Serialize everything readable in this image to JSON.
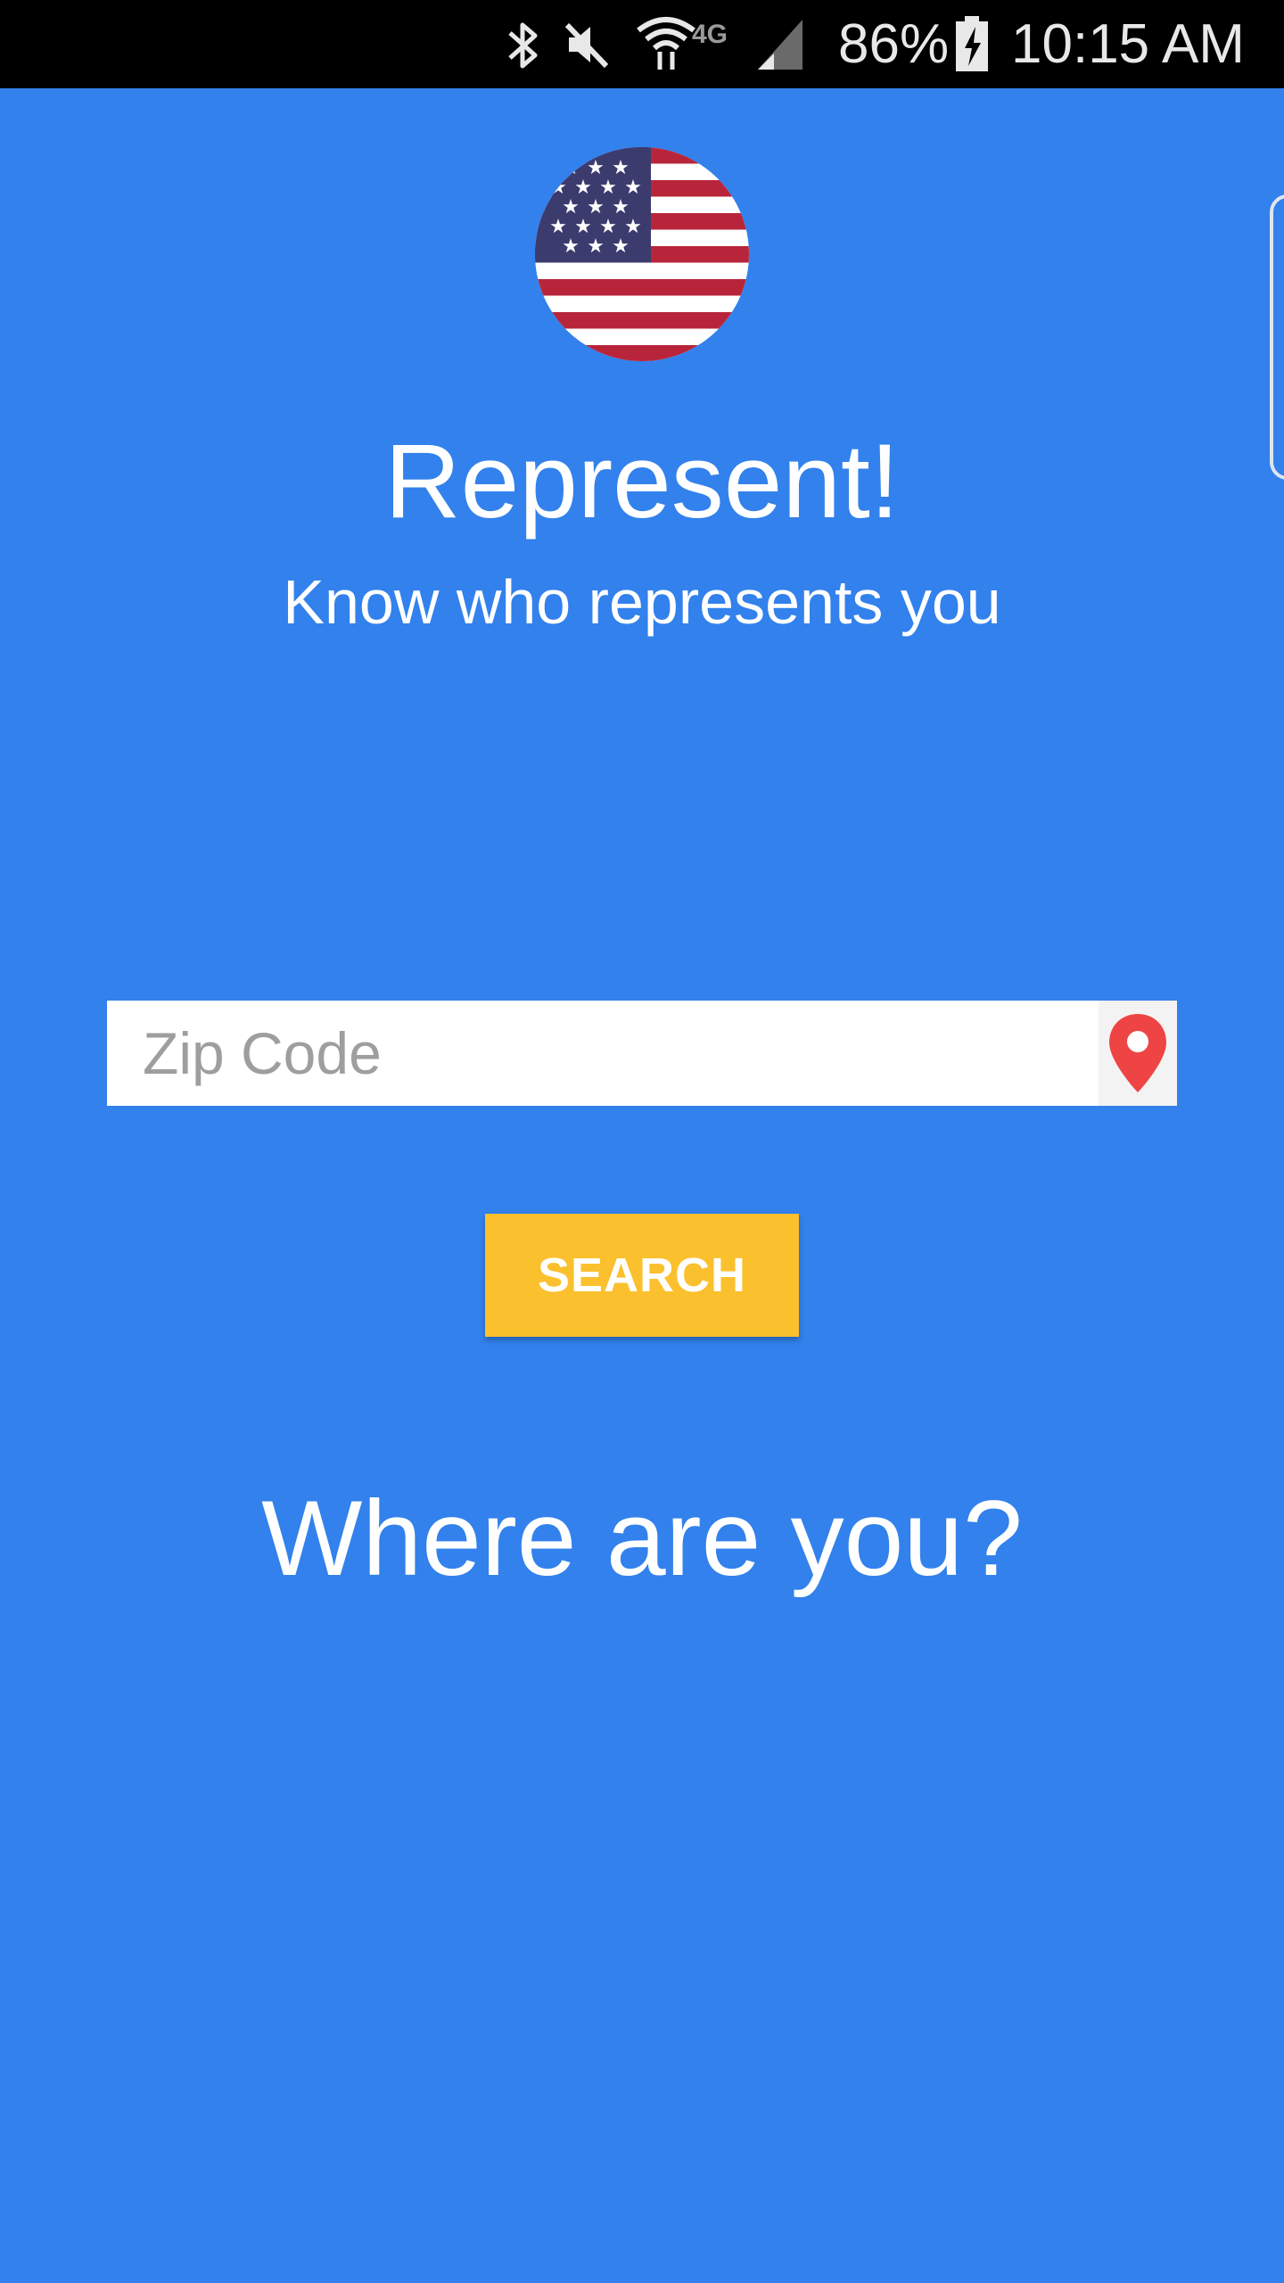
{
  "status_bar": {
    "battery": "86%",
    "time": "10:15 AM",
    "network_label": "4G",
    "icons": [
      "bluetooth-icon",
      "mute-icon",
      "wifi-icon",
      "signal-icon",
      "battery-charging-icon"
    ]
  },
  "app": {
    "title": "Represent!",
    "subtitle": "Know who represents you",
    "logo": "us-flag-icon"
  },
  "search": {
    "placeholder": "Zip Code",
    "value": "",
    "location_icon": "map-pin-icon",
    "button_label": "SEARCH"
  },
  "prompt": "Where are you?",
  "colors": {
    "background": "#3281EC",
    "button": "#FBC02D",
    "pin": "#EF4444",
    "status_bar": "#000000"
  }
}
